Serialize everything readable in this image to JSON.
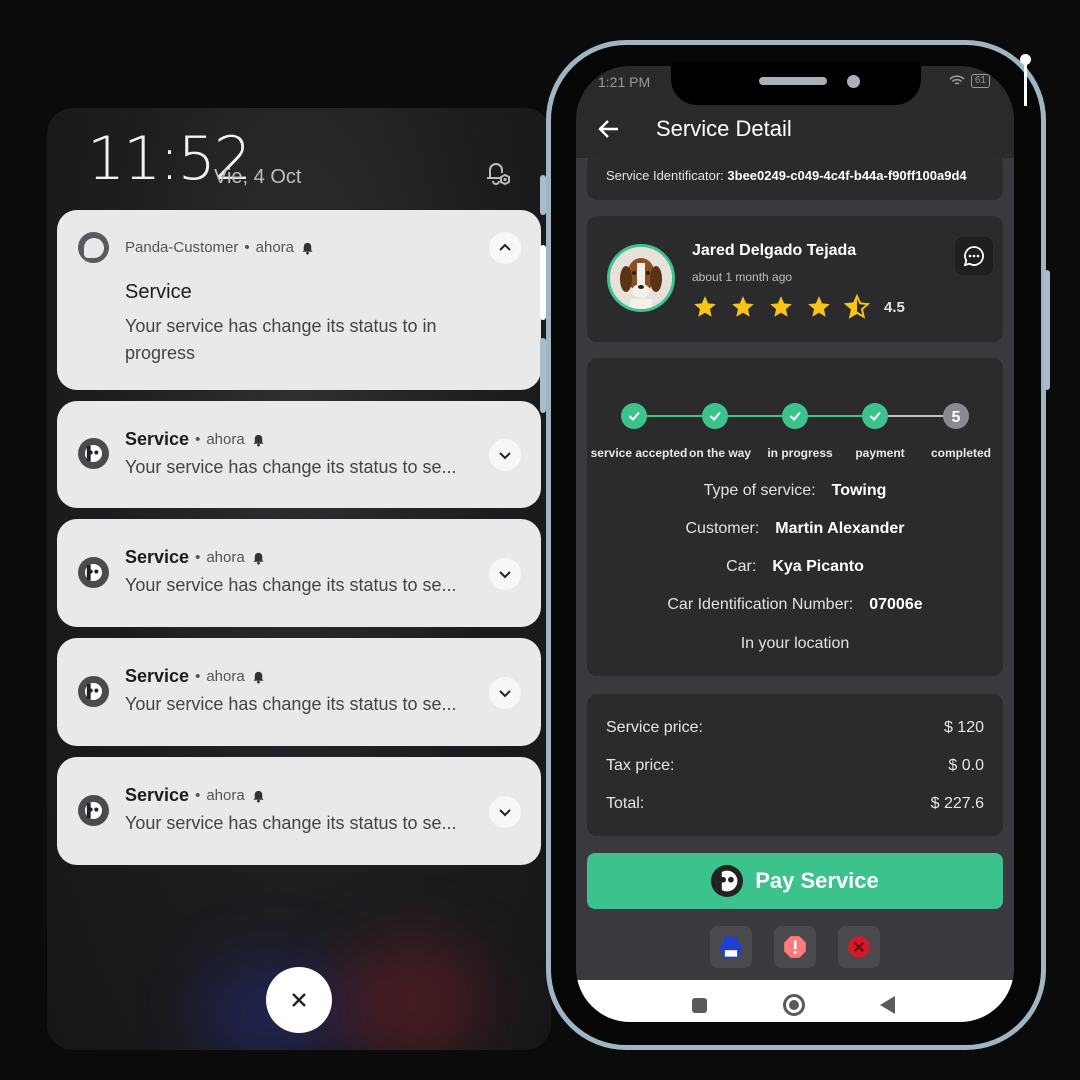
{
  "lockscreen": {
    "time": "11:52",
    "date": "Vie, 4 Oct"
  },
  "expanded_notification": {
    "app_name": "Panda-Customer",
    "time": "ahora",
    "title": "Service",
    "body": "Your service has change its status to in progress"
  },
  "collapsed_notifications": [
    {
      "title": "Service",
      "time": "ahora",
      "body": "Your service has change its status to se..."
    },
    {
      "title": "Service",
      "time": "ahora",
      "body": "Your service has change its status to se..."
    },
    {
      "title": "Service",
      "time": "ahora",
      "body": "Your service has change its status to se..."
    },
    {
      "title": "Service",
      "time": "ahora",
      "body": "Your service has change its status to se..."
    }
  ],
  "separator": "•",
  "phone": {
    "status_time": "1:21 PM",
    "battery": "61",
    "appbar_title": "Service Detail",
    "service_id_label": "Service Identificator:",
    "service_id": "3bee0249-c049-4c4f-b44a-f90ff100a9d4",
    "driver": {
      "name": "Jared Delgado Tejada",
      "ago": "about 1 month ago",
      "rating": "4.5",
      "stars": 4.5
    },
    "steps": [
      {
        "label": "service accepted",
        "done": true
      },
      {
        "label": "on the way",
        "done": true
      },
      {
        "label": "in progress",
        "done": true
      },
      {
        "label": "payment",
        "done": true
      },
      {
        "label": "completed",
        "done": false,
        "number": "5"
      }
    ],
    "details": {
      "type_label": "Type of service:",
      "type_value": "Towing",
      "customer_label": "Customer:",
      "customer_value": "Martin Alexander",
      "car_label": "Car:",
      "car_value": "Kya Picanto",
      "vin_label": "Car Identification Number:",
      "vin_value": "07006e",
      "location": "In your location"
    },
    "prices": {
      "service_label": "Service price:",
      "service_value": "$ 120",
      "tax_label": "Tax price:",
      "tax_value": "$ 0.0",
      "total_label": "Total:",
      "total_value": "$ 227.6"
    },
    "pay_button": "Pay Service",
    "colors": {
      "accent": "#3cc28c",
      "star": "#f5c518",
      "pending_step": "#8a8a90",
      "print_icon": "#1f3fd1",
      "alert_icon": "#ff7a7a",
      "cancel_icon": "#d11a2a"
    },
    "icons": {
      "actions": [
        "printer-icon",
        "alert-octagon-icon",
        "cancel-circle-icon"
      ]
    }
  }
}
